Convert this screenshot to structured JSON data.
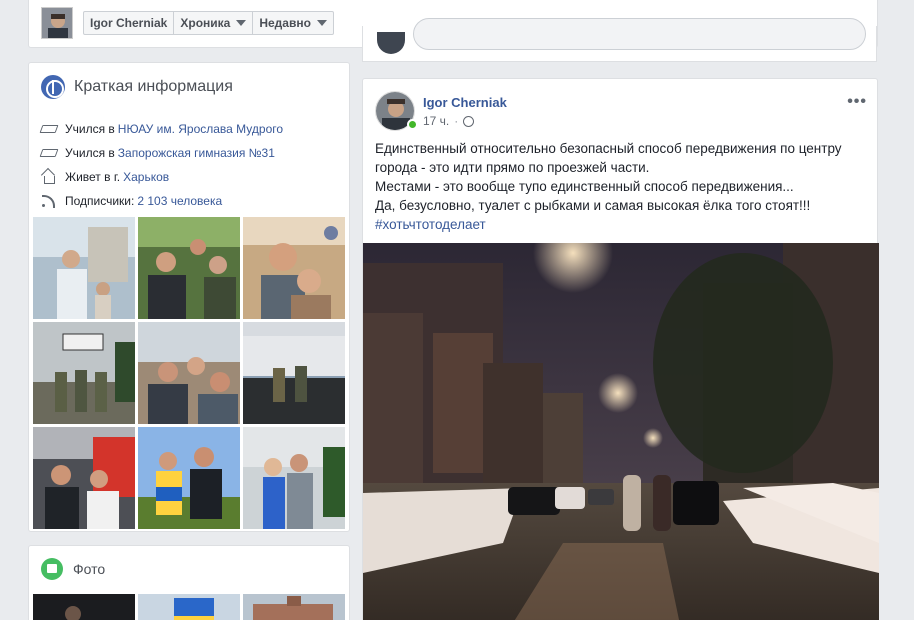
{
  "header": {
    "name_crumb": "Igor Cherniak",
    "timeline_crumb": "Хроника",
    "recent_crumb": "Недавно"
  },
  "intro": {
    "title": "Краткая информация",
    "rows": [
      {
        "prefix": "Учился в",
        "link": "НЮАУ им. Ярослава Мудрого",
        "icon": "graduation-cap-icon"
      },
      {
        "prefix": "Учился в",
        "link": "Запорожская гимназия №31",
        "icon": "graduation-cap-icon"
      },
      {
        "prefix": "Живет в г.",
        "link": "Харьков",
        "icon": "house-icon"
      },
      {
        "prefix": "Подписчики:",
        "link": "2 103 человека",
        "icon": "rss-icon"
      }
    ]
  },
  "photos": {
    "title": "Фото"
  },
  "post": {
    "author": "Igor Cherniak",
    "time": "17 ч.",
    "privacy_icon": "globe-icon",
    "lines": [
      "Единственный относительно безопасный способ передвижения по центру города - это идти прямо по проезжей части.",
      "Местами - это вообще тупо единственный способ передвижения...",
      "Да, безусловно, туалет с рыбками и самая высокая ёлка того стоят!!!"
    ],
    "hashtag": "#хотьчтотоделает",
    "more": "•••"
  },
  "colors": {
    "link": "#385898",
    "online": "#42b72a",
    "accent": "#4267b2"
  }
}
